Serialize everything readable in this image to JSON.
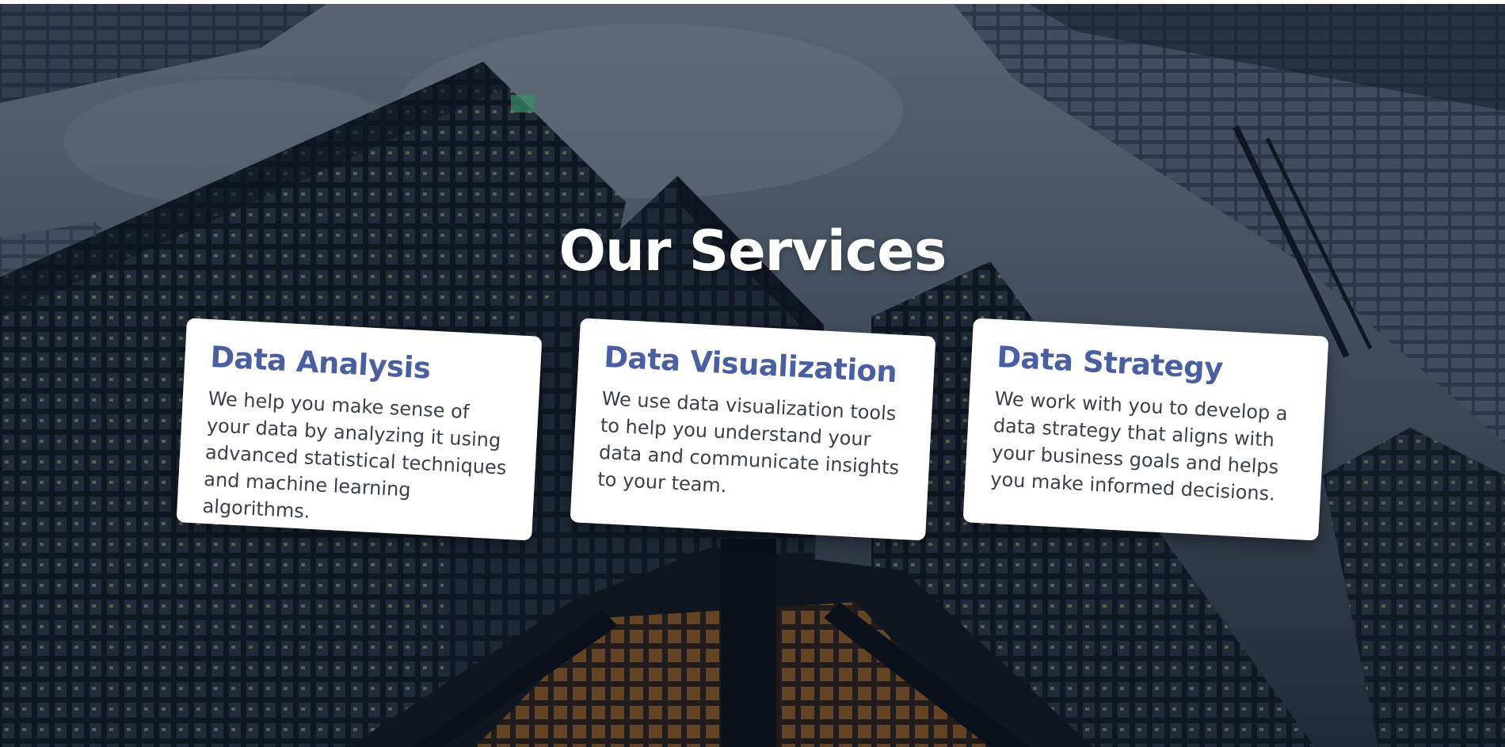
{
  "colors": {
    "title_text": "#ffffff",
    "card_background": "#ffffff",
    "card_heading": "#4a5fa2",
    "card_body": "#3a3f4a",
    "backdrop": "#101722"
  },
  "hero": {
    "title": "Our Services"
  },
  "services": [
    {
      "title": "Data Analysis",
      "description": "We help you make sense of your data by analyzing it using advanced statistical techniques and machine learning algorithms."
    },
    {
      "title": "Data Visualization",
      "description": "We use data visualization tools to help you understand your data and communicate insights to your team."
    },
    {
      "title": "Data Strategy",
      "description": "We work with you to develop a data strategy that aligns with your business goals and helps you make informed decisions."
    }
  ]
}
